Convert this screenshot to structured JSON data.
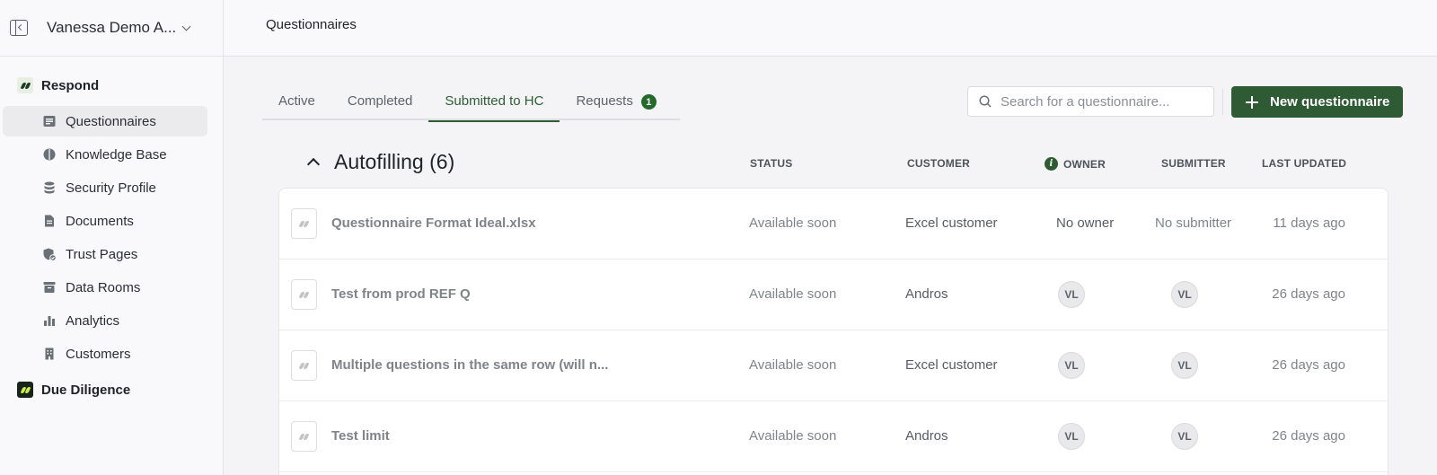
{
  "workspace": {
    "name": "Vanessa Demo A..."
  },
  "sidebar": {
    "sections": [
      {
        "label": "Respond"
      },
      {
        "label": "Due Diligence"
      }
    ],
    "items": [
      {
        "label": "Questionnaires",
        "icon": "list-icon"
      },
      {
        "label": "Knowledge Base",
        "icon": "brain-icon"
      },
      {
        "label": "Security Profile",
        "icon": "database-icon"
      },
      {
        "label": "Documents",
        "icon": "document-icon"
      },
      {
        "label": "Trust Pages",
        "icon": "shield-check-icon"
      },
      {
        "label": "Data Rooms",
        "icon": "archive-icon"
      },
      {
        "label": "Analytics",
        "icon": "bar-chart-icon"
      },
      {
        "label": "Customers",
        "icon": "building-icon"
      }
    ]
  },
  "header": {
    "title": "Questionnaires"
  },
  "tabs": [
    {
      "label": "Active"
    },
    {
      "label": "Completed"
    },
    {
      "label": "Submitted to HC"
    },
    {
      "label": "Requests",
      "count": "1"
    }
  ],
  "search": {
    "placeholder": "Search for a questionnaire..."
  },
  "new_button": {
    "label": "New questionnaire"
  },
  "group": {
    "title": "Autofilling (6)",
    "columns": {
      "status": "STATUS",
      "customer": "CUSTOMER",
      "owner": "OWNER",
      "submitter": "SUBMITTER",
      "last_updated": "LAST UPDATED"
    }
  },
  "rows": [
    {
      "name": "Questionnaire Format Ideal.xlsx",
      "status": "Available soon",
      "customer": "Excel customer",
      "owner": "No owner",
      "submitter": "No submitter",
      "updated": "11 days ago"
    },
    {
      "name": "Test from prod REF Q",
      "status": "Available soon",
      "customer": "Andros",
      "owner": "VL",
      "submitter": "VL",
      "updated": "26 days ago"
    },
    {
      "name": "Multiple questions in the same row (will n...",
      "status": "Available soon",
      "customer": "Excel customer",
      "owner": "VL",
      "submitter": "VL",
      "updated": "26 days ago"
    },
    {
      "name": "Test limit",
      "status": "Available soon",
      "customer": "Andros",
      "owner": "VL",
      "submitter": "VL",
      "updated": "26 days ago"
    }
  ],
  "colors": {
    "brand_green": "#2f5b34",
    "accent_lime": "#c9ef4a"
  }
}
